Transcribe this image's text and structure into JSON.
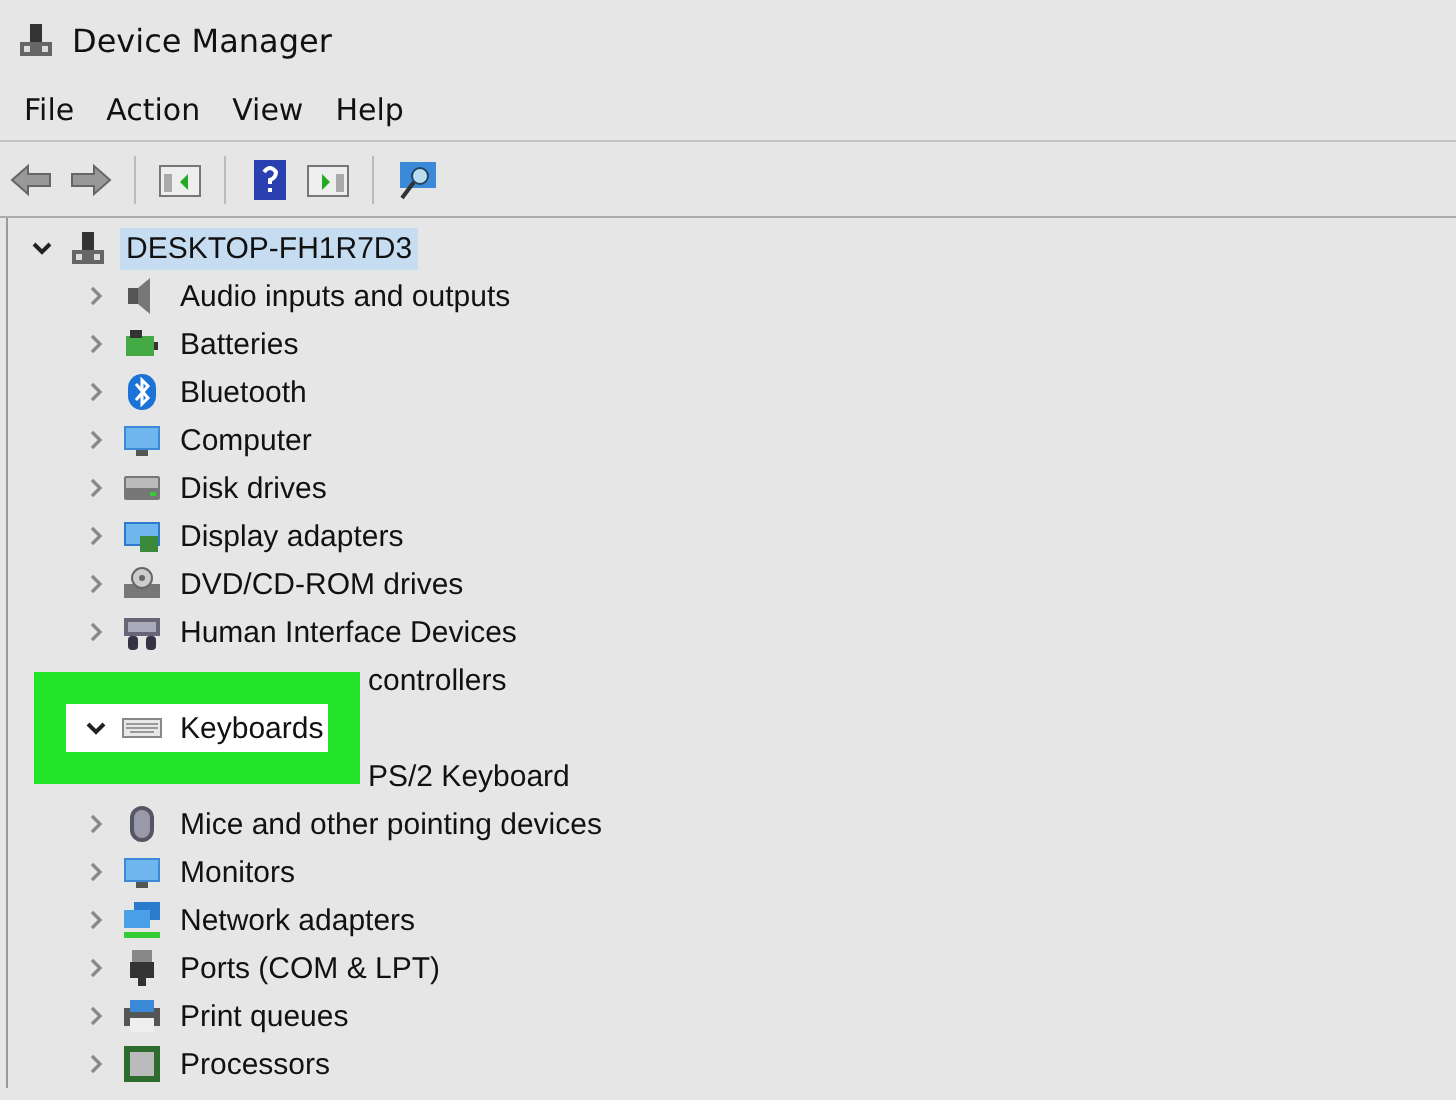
{
  "window": {
    "title": "Device Manager"
  },
  "menu": [
    "File",
    "Action",
    "View",
    "Help"
  ],
  "tree": {
    "label": "DESKTOP-FH1R7D3",
    "expanded": true,
    "selected": true,
    "children": [
      {
        "label": "Audio inputs and outputs",
        "expanded": false
      },
      {
        "label": "Batteries",
        "expanded": false
      },
      {
        "label": "Bluetooth",
        "expanded": false
      },
      {
        "label": "Computer",
        "expanded": false
      },
      {
        "label": "Disk drives",
        "expanded": false
      },
      {
        "label": "Display adapters",
        "expanded": false
      },
      {
        "label": "DVD/CD-ROM drives",
        "expanded": false
      },
      {
        "label": "Human Interface Devices",
        "expanded": false
      },
      {
        "label": "controllers",
        "obscured": true
      },
      {
        "label": "Keyboards",
        "expanded": true,
        "highlighted": true,
        "children": [
          {
            "label": "PS/2 Keyboard",
            "obscured": true
          }
        ]
      },
      {
        "label": "Mice and other pointing devices",
        "expanded": false
      },
      {
        "label": "Monitors",
        "expanded": false
      },
      {
        "label": "Network adapters",
        "expanded": false
      },
      {
        "label": "Ports (COM & LPT)",
        "expanded": false
      },
      {
        "label": "Print queues",
        "expanded": false
      },
      {
        "label": "Processors",
        "expanded": false
      }
    ]
  }
}
